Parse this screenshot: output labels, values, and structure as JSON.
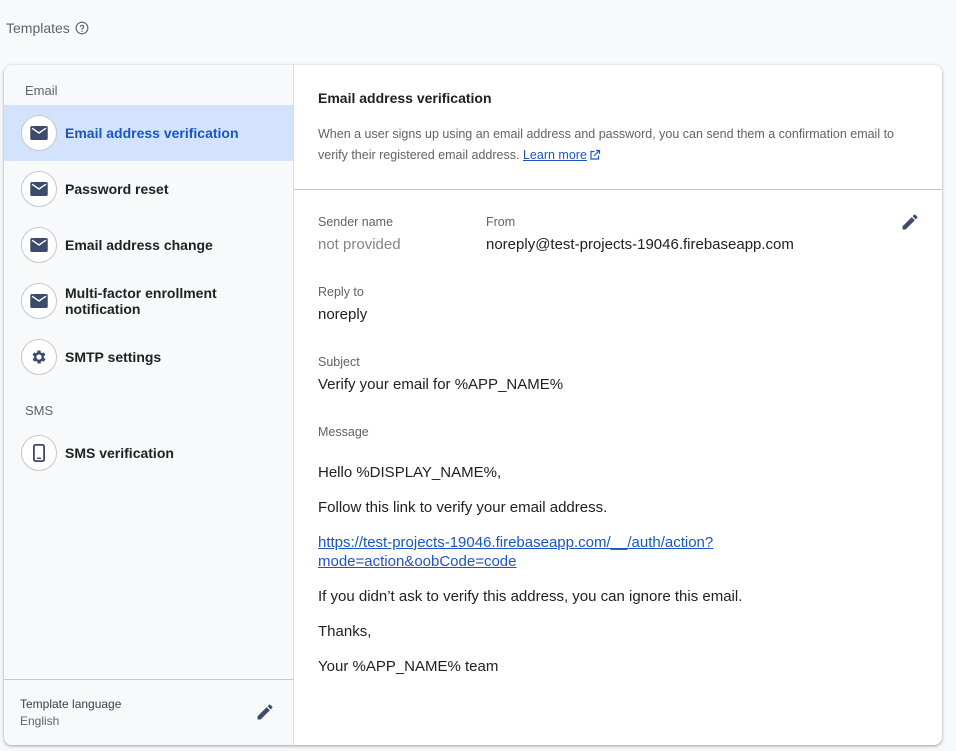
{
  "page": {
    "title": "Templates",
    "help_icon": "help-circle-icon"
  },
  "sidebar": {
    "email_section": "Email",
    "sms_section": "SMS",
    "email_items": [
      {
        "label": "Email address verification",
        "icon": "mail-icon",
        "active": true
      },
      {
        "label": "Password reset",
        "icon": "mail-icon",
        "active": false
      },
      {
        "label": "Email address change",
        "icon": "mail-icon",
        "active": false
      },
      {
        "label": "Multi-factor enrollment notification",
        "icon": "mail-icon",
        "active": false
      },
      {
        "label": "SMTP settings",
        "icon": "gear-icon",
        "active": false
      }
    ],
    "sms_items": [
      {
        "label": "SMS verification",
        "icon": "phone-icon",
        "active": false
      }
    ],
    "footer": {
      "title": "Template language",
      "value": "English",
      "edit_icon": "pencil-icon"
    }
  },
  "main": {
    "title": "Email address verification",
    "description": "When a user signs up using an email address and password, you can send them a confirmation email to verify their registered email address.",
    "learn_more": "Learn more",
    "sender_name_label": "Sender name",
    "sender_name_value": "not provided",
    "from_label": "From",
    "from_value": "noreply@test-projects-19046.firebaseapp.com",
    "reply_to_label": "Reply to",
    "reply_to_value": "noreply",
    "subject_label": "Subject",
    "subject_value": "Verify your email for %APP_NAME%",
    "message_label": "Message",
    "message": {
      "greeting": "Hello %DISPLAY_NAME%,",
      "instruction": "Follow this link to verify your email address.",
      "link": "https://test-projects-19046.firebaseapp.com/__/auth/action?mode=action&oobCode=code",
      "ignore": "If you didn’t ask to verify this address, you can ignore this email.",
      "thanks": "Thanks,",
      "signature": "Your %APP_NAME% team"
    }
  },
  "colors": {
    "accent": "#1a56c4",
    "active_bg": "#d3e3fd",
    "icon": "#3c4a6b"
  }
}
